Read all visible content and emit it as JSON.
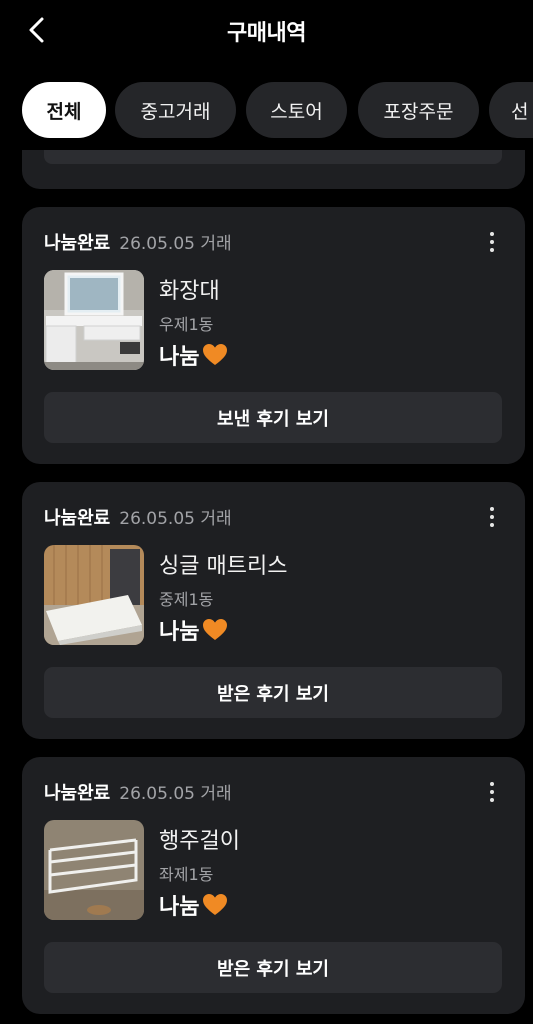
{
  "header": {
    "title": "구매내역"
  },
  "tabs": [
    {
      "label": "전체",
      "active": true
    },
    {
      "label": "중고거래"
    },
    {
      "label": "스토어"
    },
    {
      "label": "포장주문"
    },
    {
      "label": "선"
    }
  ],
  "colors": {
    "background": "#000000",
    "card": "#1e1f22",
    "button": "#2c2d31",
    "heart": "#f08a24"
  },
  "orders": [
    {
      "status": "나눔완료",
      "date": "26.05.05 거래",
      "item": "화장대",
      "location": "우제1동",
      "price": "나눔",
      "review_button": "보낸 후기 보기",
      "thumb_icon": "vanity-photo"
    },
    {
      "status": "나눔완료",
      "date": "26.05.05 거래",
      "item": "싱글 매트리스",
      "location": "중제1동",
      "price": "나눔",
      "review_button": "받은 후기 보기",
      "thumb_icon": "mattress-photo"
    },
    {
      "status": "나눔완료",
      "date": "26.05.05 거래",
      "item": "행주걸이",
      "location": "좌제1동",
      "price": "나눔",
      "review_button": "받은 후기 보기",
      "thumb_icon": "towel-rack-photo"
    }
  ]
}
